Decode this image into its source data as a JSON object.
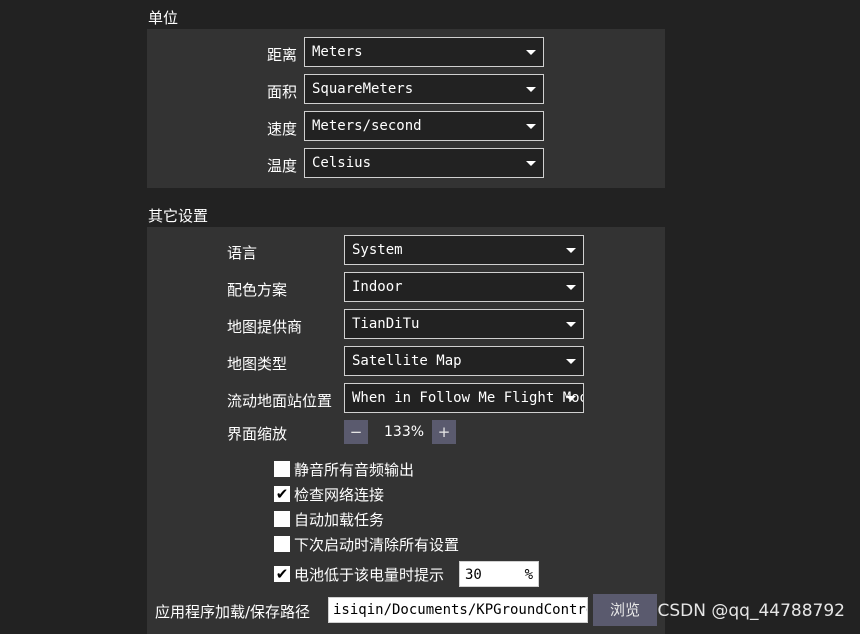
{
  "units": {
    "title": "单位",
    "rows": [
      {
        "label": "距离",
        "value": "Meters"
      },
      {
        "label": "面积",
        "value": "SquareMeters"
      },
      {
        "label": "速度",
        "value": "Meters/second"
      },
      {
        "label": "温度",
        "value": "Celsius"
      }
    ]
  },
  "other": {
    "title": "其它设置",
    "rows": [
      {
        "label": "语言",
        "value": "System"
      },
      {
        "label": "配色方案",
        "value": "Indoor"
      },
      {
        "label": "地图提供商",
        "value": "TianDiTu"
      },
      {
        "label": "地图类型",
        "value": "Satellite Map"
      },
      {
        "label": "流动地面站位置",
        "value": "When in Follow Me Flight Mode"
      }
    ],
    "scale": {
      "label": "界面缩放",
      "minus": "−",
      "value": "133%",
      "plus": "+"
    },
    "checkboxes": [
      {
        "label": "静音所有音频输出",
        "checked": false
      },
      {
        "label": "检查网络连接",
        "checked": true
      },
      {
        "label": "自动加载任务",
        "checked": false
      },
      {
        "label": "下次启动时清除所有设置",
        "checked": false
      },
      {
        "label": "电池低于该电量时提示",
        "checked": true
      }
    ],
    "battery": {
      "value": "30",
      "unit": "%"
    },
    "path": {
      "label": "应用程序加载/保存路径",
      "value": "isiqin/Documents/KPGroundControl",
      "browse": "浏览"
    }
  },
  "watermark": "CSDN @qq_44788792",
  "check_glyph": "✔"
}
